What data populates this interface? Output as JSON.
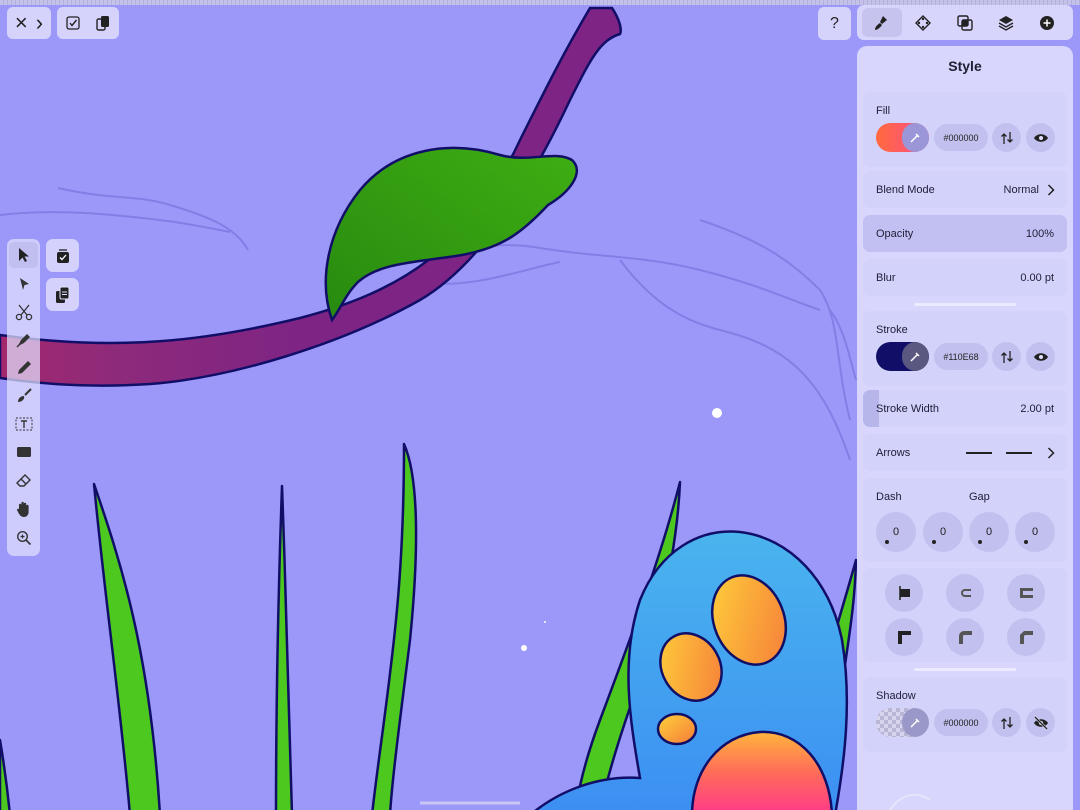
{
  "topbar": {
    "close_label": "×",
    "forward_label": "›",
    "help_label": "?"
  },
  "tools": [
    {
      "name": "select",
      "icon": "select-arrow-icon",
      "active": true
    },
    {
      "name": "direct-select",
      "icon": "direct-select-icon"
    },
    {
      "name": "scissors",
      "icon": "scissors-icon"
    },
    {
      "name": "pen",
      "icon": "pen-icon"
    },
    {
      "name": "pencil",
      "icon": "pencil-icon"
    },
    {
      "name": "brush",
      "icon": "brush-icon"
    },
    {
      "name": "text",
      "icon": "text-icon"
    },
    {
      "name": "shape",
      "icon": "rectangle-icon"
    },
    {
      "name": "eraser",
      "icon": "eraser-icon"
    },
    {
      "name": "hand",
      "icon": "hand-icon"
    },
    {
      "name": "zoom",
      "icon": "zoom-icon"
    }
  ],
  "tabs": [
    "style-tab",
    "geometry-tab",
    "boolean-tab",
    "layers-tab",
    "more-tab"
  ],
  "panel": {
    "title": "Style",
    "fill": {
      "label": "Fill",
      "hex": "#000000"
    },
    "blend_mode": {
      "label": "Blend Mode",
      "value": "Normal"
    },
    "opacity": {
      "label": "Opacity",
      "value": "100%"
    },
    "blur": {
      "label": "Blur",
      "value": "0.00 pt"
    },
    "stroke": {
      "label": "Stroke",
      "hex": "#110E68"
    },
    "stroke_width": {
      "label": "Stroke Width",
      "value": "2.00 pt"
    },
    "arrows": {
      "label": "Arrows"
    },
    "dash": {
      "label": "Dash",
      "gap_label": "Gap",
      "values": [
        "0",
        "0",
        "0",
        "0"
      ]
    },
    "shadow": {
      "label": "Shadow",
      "hex": "#000000"
    }
  },
  "colors": {
    "canvas": "#9C98FA",
    "stroke": "#110E68",
    "vine": "#7D2485",
    "leaf": "#2F9511",
    "grass": "#4CC81E",
    "creature": "#4AA6F0"
  }
}
